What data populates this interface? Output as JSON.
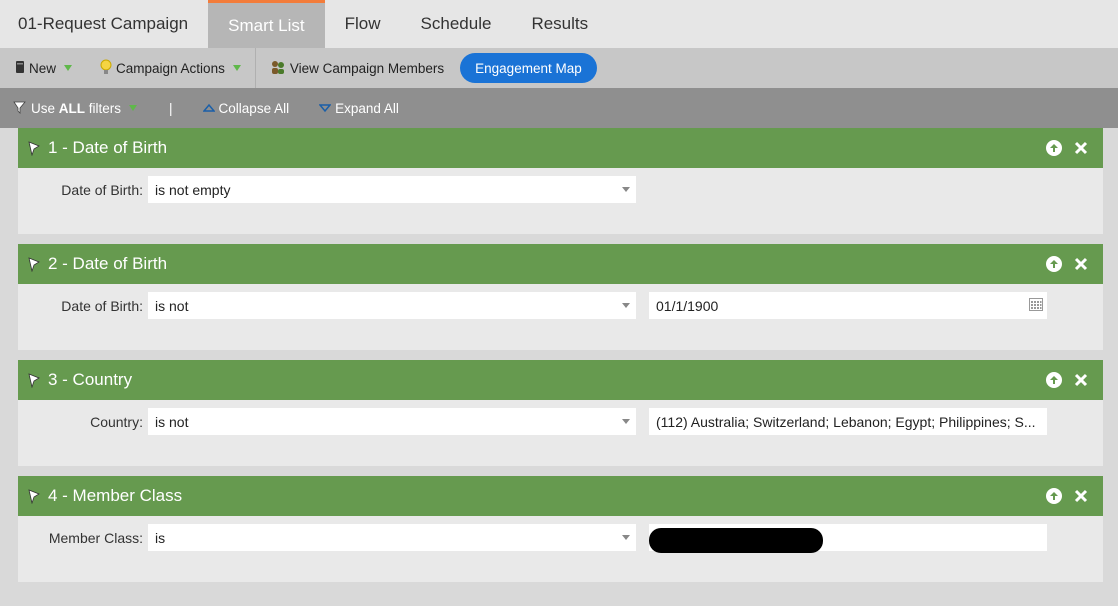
{
  "tabs": [
    {
      "label": "01-Request Campaign"
    },
    {
      "label": "Smart List"
    },
    {
      "label": "Flow"
    },
    {
      "label": "Schedule"
    },
    {
      "label": "Results"
    }
  ],
  "toolbar": {
    "new_label": "New",
    "campaign_actions_label": "Campaign Actions",
    "view_members_label": "View Campaign Members",
    "engagement_map_label": "Engagement Map"
  },
  "filterbar": {
    "use_label_prefix": "Use ",
    "use_label_bold": "ALL",
    "use_label_suffix": " filters",
    "divider": "|",
    "collapse_label": "Collapse All",
    "expand_label": "Expand All"
  },
  "filters": [
    {
      "title": "1 - Date of Birth",
      "field_label": "Date of Birth:",
      "operator": "is not empty",
      "value": ""
    },
    {
      "title": "2 - Date of Birth",
      "field_label": "Date of Birth:",
      "operator": "is not",
      "value": "01/1/1900"
    },
    {
      "title": "3 - Country",
      "field_label": "Country:",
      "operator": "is not",
      "value": "(112) Australia; Switzerland; Lebanon; Egypt; Philippines; S..."
    },
    {
      "title": "4 - Member Class",
      "field_label": "Member Class:",
      "operator": "is",
      "value": ""
    }
  ],
  "colors": {
    "accent_tab": "#f37c3a",
    "filter_header": "#669a4f",
    "engagement_button": "#1a73d6",
    "triangle": "#5fb84a"
  }
}
